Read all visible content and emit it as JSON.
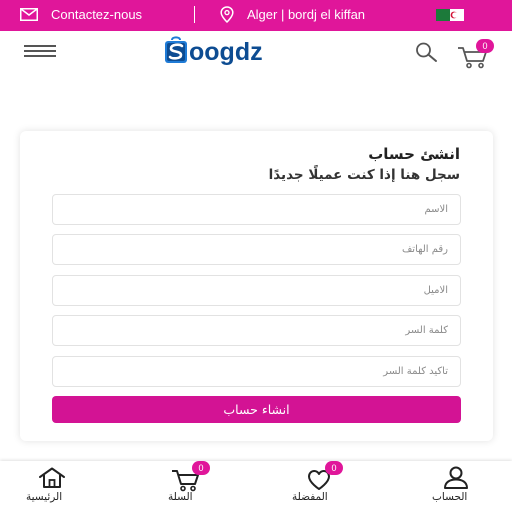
{
  "topbar": {
    "contact_label": "Contactez-nous",
    "location_label": "Alger | bordj el kiffan",
    "background": "#e0169a",
    "icons": [
      "mail-icon",
      "location-pin-icon",
      "algeria-flag-icon"
    ]
  },
  "header": {
    "logo_text": "Soogdz",
    "cart_count": "0",
    "icons": [
      "menu-icon",
      "search-icon",
      "cart-icon"
    ]
  },
  "register": {
    "title": "انشئ حساب",
    "subtitle": "سجل هنا إذا كنت عميلًا جديدًا",
    "fields": {
      "name_placeholder": "الاسم",
      "phone_placeholder": "رقم الهاتف",
      "email_placeholder": "الاميل",
      "password_placeholder": "كلمة السر",
      "confirm_password_placeholder": "تأكيد كلمة السر"
    },
    "submit_label": "انشاء حساب",
    "accent": "#d31394"
  },
  "bottom_nav": {
    "home_label": "الرئيسية",
    "cart_label": "السلة",
    "cart_count": "0",
    "wishlist_label": "المفضلة",
    "wishlist_count": "0",
    "account_label": "الحساب"
  }
}
